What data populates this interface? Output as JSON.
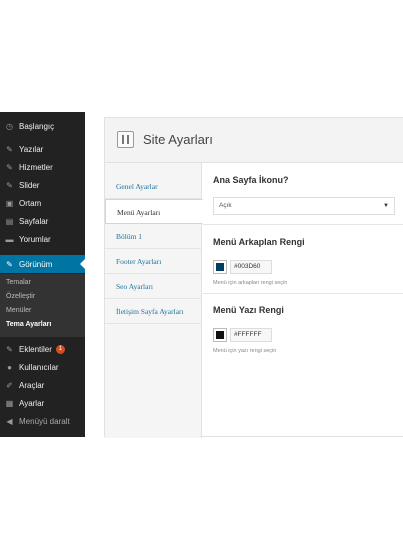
{
  "sidebar": {
    "items": [
      {
        "label": "Başlangıç",
        "icon": "dashboard-icon"
      },
      {
        "label": "Yazılar",
        "icon": "pin-icon"
      },
      {
        "label": "Hizmetler",
        "icon": "pin-icon"
      },
      {
        "label": "Slider",
        "icon": "pin-icon"
      },
      {
        "label": "Ortam",
        "icon": "media-icon"
      },
      {
        "label": "Sayfalar",
        "icon": "pages-icon"
      },
      {
        "label": "Yorumlar",
        "icon": "comments-icon"
      },
      {
        "label": "Görünüm",
        "icon": "appearance-icon"
      }
    ],
    "submenu": [
      "Temalar",
      "Özelleştir",
      "Menüler",
      "Tema Ayarları"
    ],
    "lower_items": [
      {
        "label": "Eklentiler",
        "icon": "plugins-icon",
        "badge": "1"
      },
      {
        "label": "Kullanıcılar",
        "icon": "users-icon"
      },
      {
        "label": "Araçlar",
        "icon": "tools-icon"
      },
      {
        "label": "Ayarlar",
        "icon": "settings-icon"
      }
    ],
    "collapse_label": "Menüyü daralt",
    "active_color": "#0074a2"
  },
  "panel": {
    "title": "Site Ayarları",
    "tabs": [
      "Genel Ayarlar",
      "Menü Ayarları",
      "Bölüm 1",
      "Footer Ayarları",
      "Seo Ayarları",
      "İletişim Sayfa Ayarları"
    ],
    "sections": {
      "favicon": {
        "title": "Ana Sayfa İkonu?",
        "selected": "Açık"
      },
      "menu_bg": {
        "title": "Menü Arkaplan Rengi",
        "value": "#003D60",
        "hint": "Menü için arkaplan rengi seçin"
      },
      "menu_text": {
        "title": "Menü Yazı Rengi",
        "value": "#FFFFFF",
        "hint": "Menü için yazı rengi seçin"
      }
    }
  }
}
